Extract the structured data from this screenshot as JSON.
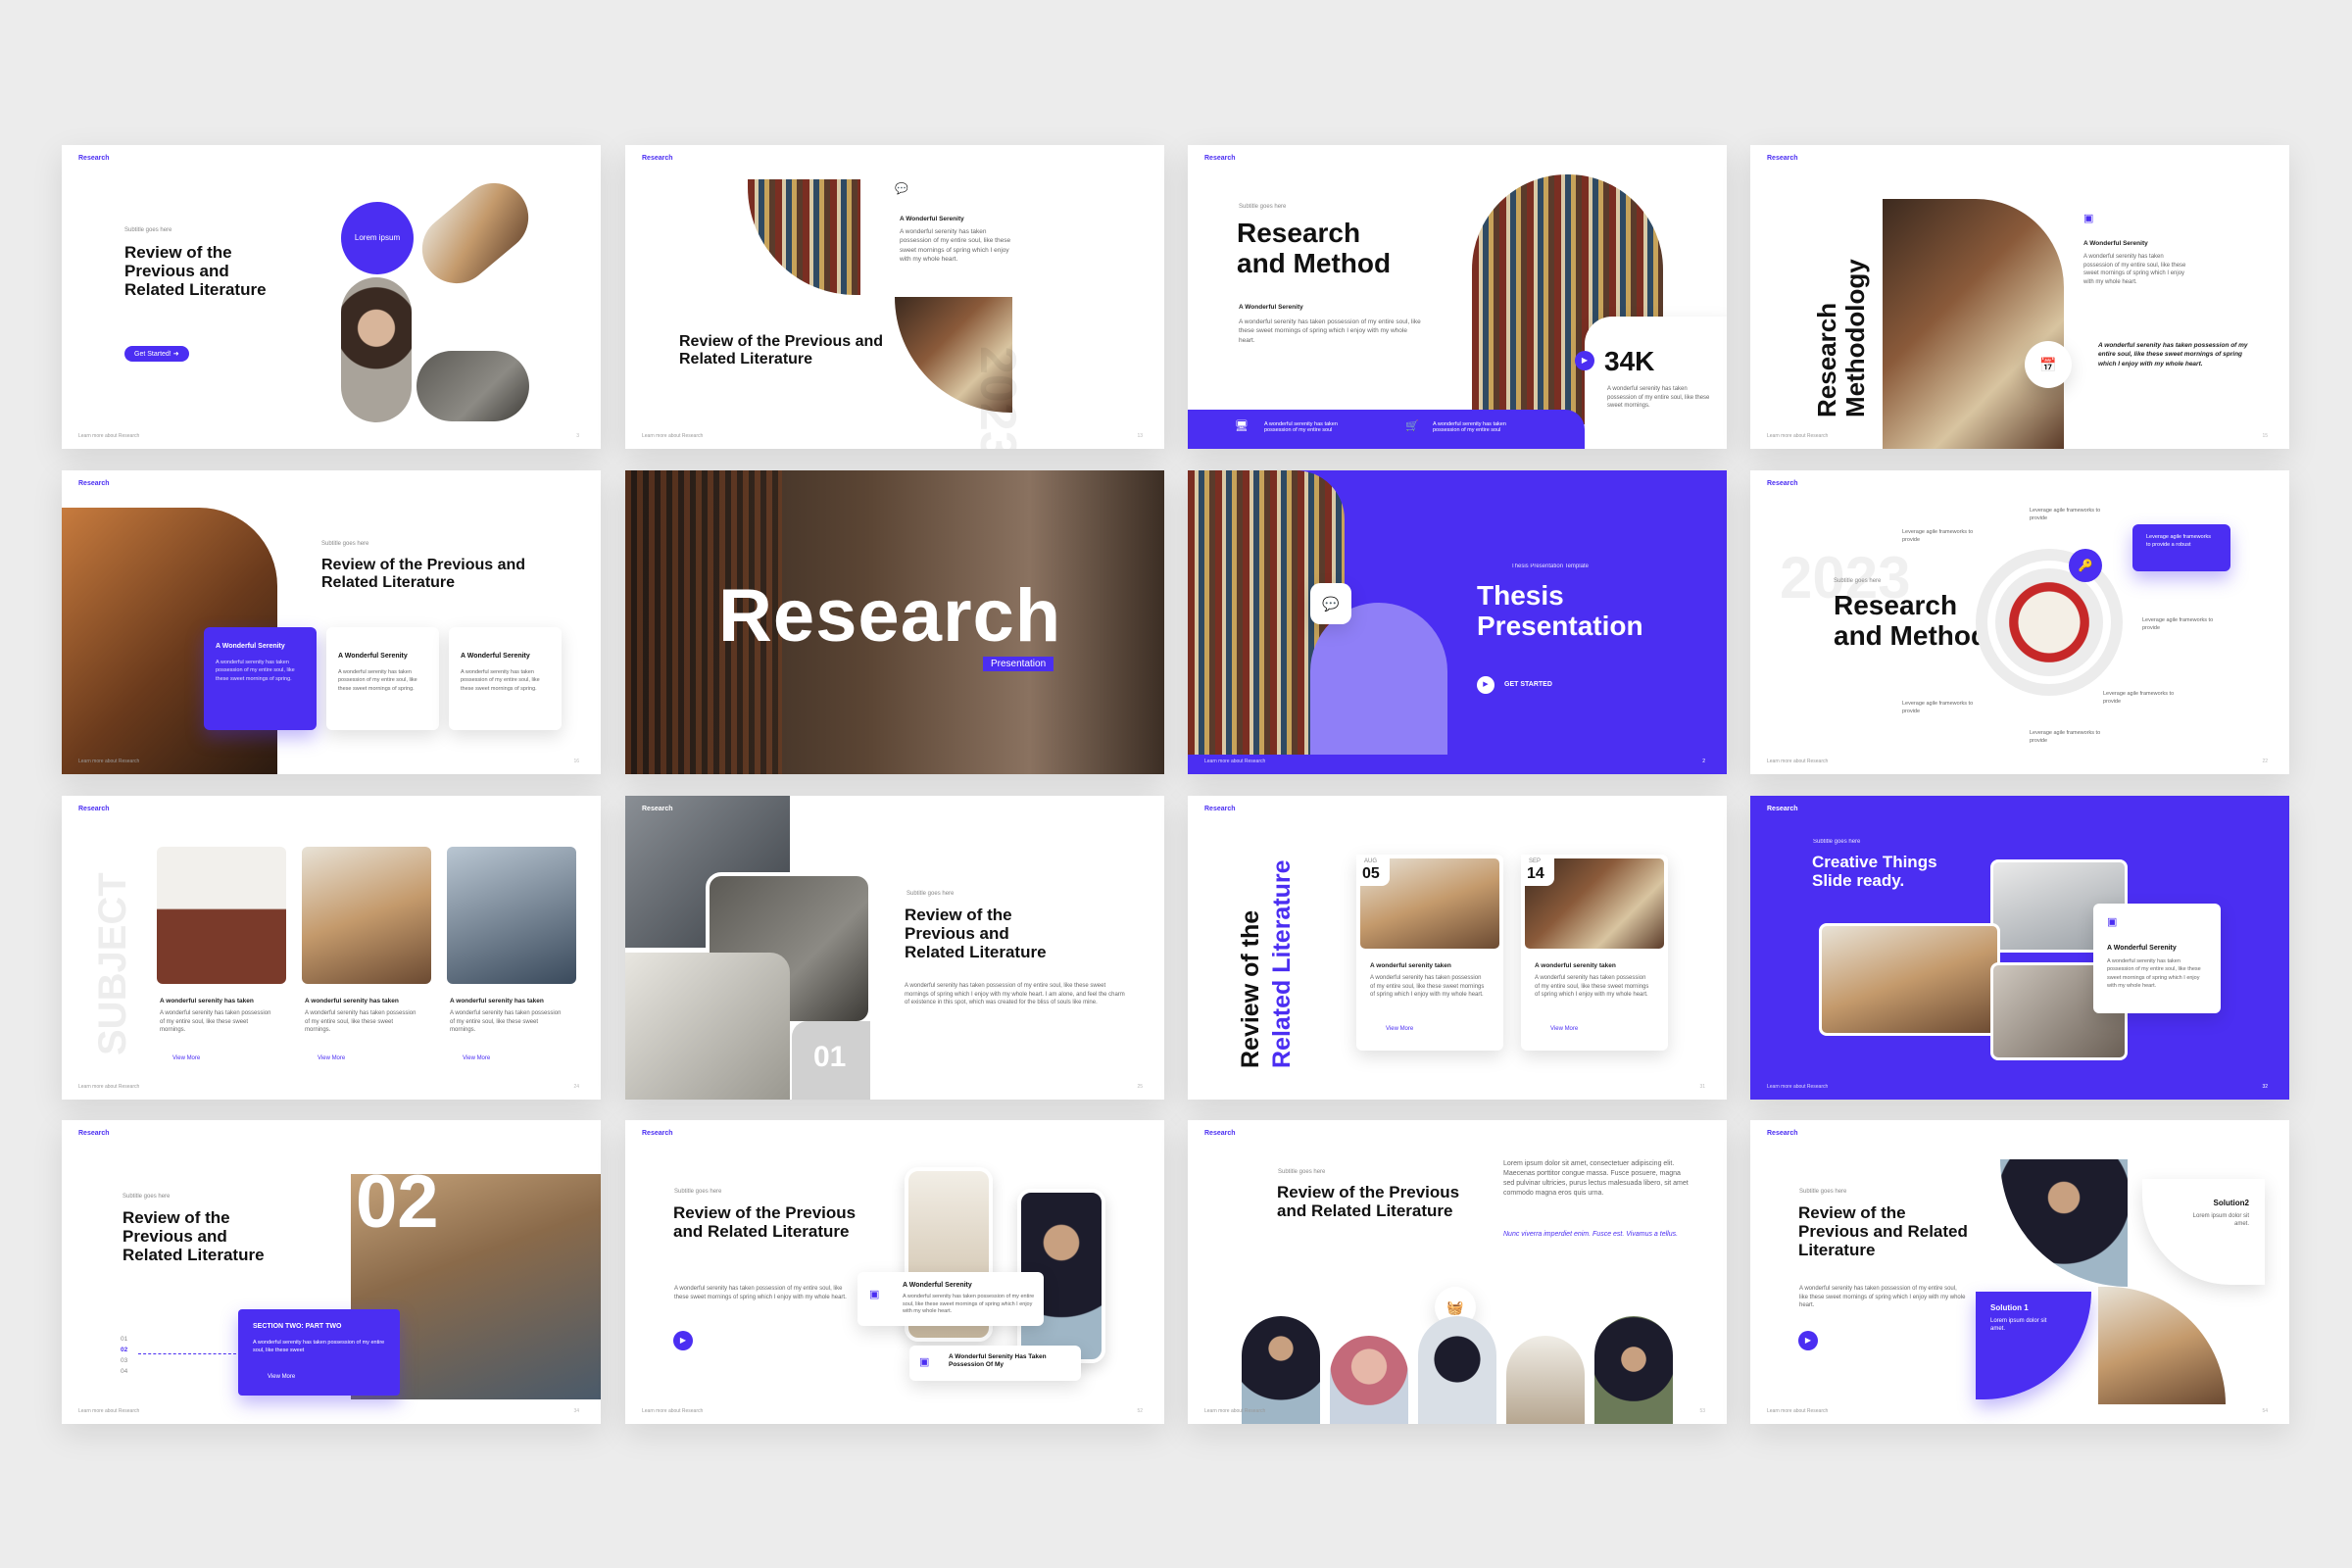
{
  "brand": "Research",
  "footer": "Learn more about Research",
  "sub": "Subtitle goes here",
  "wonder": "A Wonderful Serenity",
  "body_short": "A wonderful serenity has taken possession of my entire soul, like these sweet mornings of spring which I enjoy with my whole heart.",
  "body_long": "A wonderful serenity has taken possession of my entire soul, like these sweet mornings of spring which I enjoy with my whole heart. I am alone, and feel the charm of existence in this spot, which was created for the bliss of souls like mine.",
  "view_more": "View More",
  "s1": {
    "title": "Review of the Previous and Related Literature",
    "btn": "Get Started!",
    "badge": "Lorem ipsum",
    "num": "3"
  },
  "s2": {
    "title": "Review of the Previous and Related Literature",
    "year": "2023",
    "num": "13"
  },
  "s3": {
    "title": "Research and Method",
    "stat": "34K",
    "stat_text": "A wonderful serenity has taken possession of my entire soul, like these sweet mornings.",
    "bar1": "A wonderful serenity has taken possession of my entire soul",
    "bar2": "A wonderful serenity has taken possession of my entire soul"
  },
  "s4": {
    "title": "Research Methodology",
    "italic": "A wonderful serenity has taken possession of my entire soul, like these sweet mornings of spring which I enjoy with my whole heart.",
    "num": "15"
  },
  "s5": {
    "title": "Review of the Previous and Related Literature",
    "card": "A wonderful serenity has taken possession of my entire soul, like these sweet mornings of spring.",
    "num": "16"
  },
  "s6": {
    "title": "Research",
    "badge": "Presentation"
  },
  "s7": {
    "sub": "Thesis Presentation Template",
    "title": "Thesis Presentation",
    "btn": "GET STARTED",
    "num": "2"
  },
  "s8": {
    "title": "Research and Method",
    "ghost": "2023",
    "lev": "Leverage agile frameworks to provide",
    "lev_card": "Leverage agile frameworks to provide a robust",
    "num": "22"
  },
  "s9": {
    "ghost": "SUBJECT",
    "cap": "A wonderful serenity has taken",
    "text": "A wonderful serenity has taken possession of my entire soul, like these sweet mornings.",
    "num": "24"
  },
  "s10": {
    "title": "Review of the Previous and Related Literature",
    "num_big": "01",
    "num": "25"
  },
  "s11": {
    "title_a": "Review of the",
    "title_b": "Related Literature",
    "m1": "AUG",
    "d1": "05",
    "m2": "SEP",
    "d2": "14",
    "cap": "A wonderful serenity taken",
    "num": "31"
  },
  "s12": {
    "title": "Creative Things Slide ready.",
    "num": "32"
  },
  "s13": {
    "title": "Review of the Previous and Related Literature",
    "big": "02",
    "section": "SECTION TWO: PART TWO",
    "text": "A wonderful serenity has taken possession of my entire soul, like these sweet",
    "list": [
      "01",
      "02",
      "03",
      "04"
    ],
    "num": "34"
  },
  "s14": {
    "title": "Review of the Previous and Related Literature",
    "pill": "A Wonderful Serenity Has Taken Possession Of My",
    "num": "52"
  },
  "s15": {
    "title": "Review of the Previous and Related Literature",
    "lorem": "Lorem ipsum dolor sit amet, consectetuer adipiscing elit. Maecenas porttitor congue massa. Fusce posuere, magna sed pulvinar ultricies, purus lectus malesuada libero, sit amet commodo magna eros quis urna.",
    "lorem_it": "Nunc viverra imperdiet enim. Fusce est. Vivamus a tellus.",
    "num": "53"
  },
  "s16": {
    "title": "Review of the Previous and Related Literature",
    "sol1": "Solution 1",
    "sol2": "Solution2",
    "lorem": "Lorem ipsum dolor sit amet.",
    "num": "54"
  },
  "colors": {
    "accent": "#4b2ef2",
    "bg": "#ececec"
  }
}
